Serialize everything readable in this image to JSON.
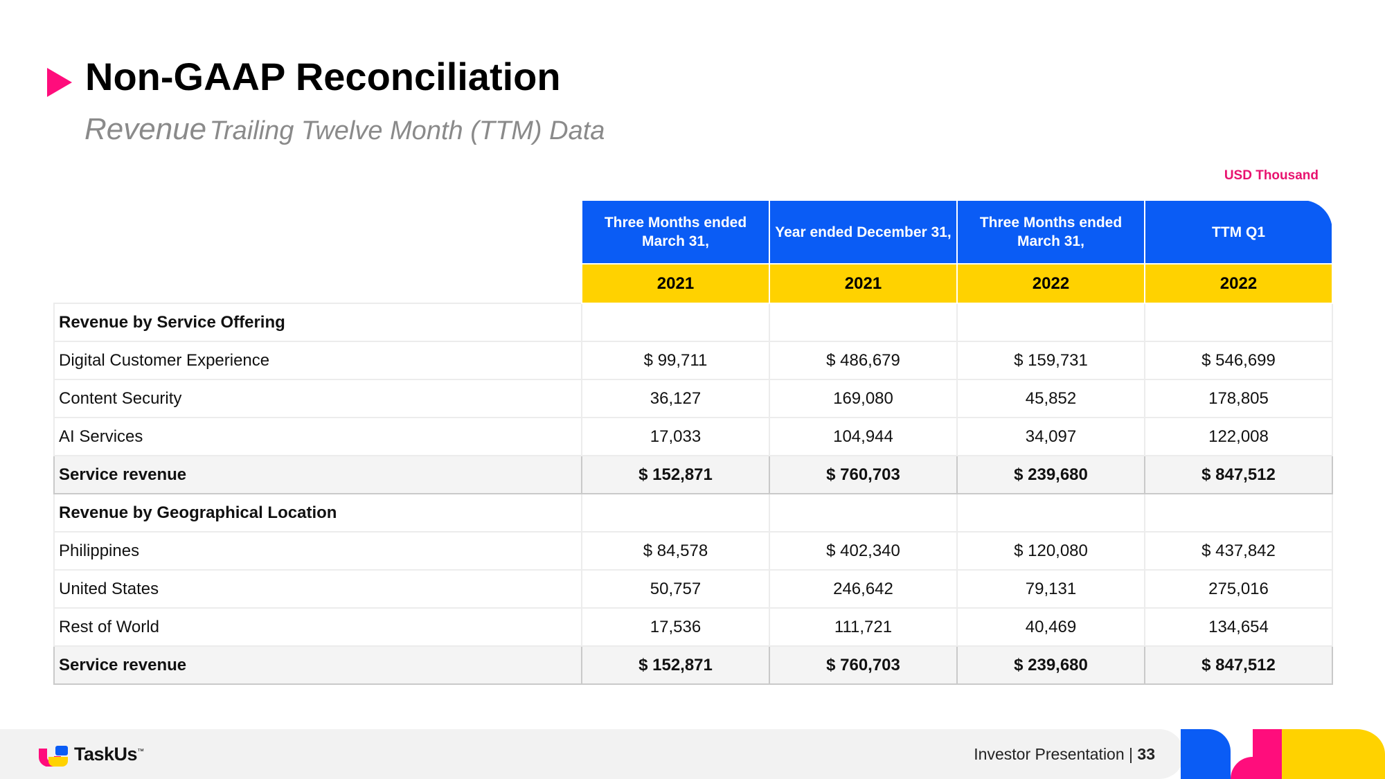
{
  "title": "Non-GAAP Reconciliation",
  "subtitle": {
    "primary": "Revenue",
    "secondary": "Trailing Twelve Month (TTM) Data"
  },
  "units": "USD Thousand",
  "table": {
    "headers": [
      {
        "period": "Three Months ended March 31,",
        "year": "2021"
      },
      {
        "period": "Year ended December 31,",
        "year": "2021"
      },
      {
        "period": "Three Months ended March 31,",
        "year": "2022"
      },
      {
        "period": "TTM Q1",
        "year": "2022"
      }
    ],
    "rows": [
      {
        "kind": "section",
        "label": "Revenue by Service Offering",
        "values": [
          "",
          "",
          "",
          ""
        ]
      },
      {
        "kind": "data",
        "label": "Digital Customer Experience",
        "values": [
          "$ 99,711",
          "$ 486,679",
          "$ 159,731",
          "$ 546,699"
        ]
      },
      {
        "kind": "data",
        "label": "Content Security",
        "values": [
          "36,127",
          "169,080",
          "45,852",
          "178,805"
        ]
      },
      {
        "kind": "data",
        "label": "AI Services",
        "values": [
          "17,033",
          "104,944",
          "34,097",
          "122,008"
        ]
      },
      {
        "kind": "total",
        "label": "Service revenue",
        "values": [
          "$ 152,871",
          "$ 760,703",
          "$ 239,680",
          "$ 847,512"
        ]
      },
      {
        "kind": "section",
        "label": "Revenue by Geographical Location",
        "values": [
          "",
          "",
          "",
          ""
        ]
      },
      {
        "kind": "data",
        "label": "Philippines",
        "values": [
          "$ 84,578",
          "$ 402,340",
          "$ 120,080",
          "$ 437,842"
        ]
      },
      {
        "kind": "data",
        "label": "United States",
        "values": [
          "50,757",
          "246,642",
          "79,131",
          "275,016"
        ]
      },
      {
        "kind": "data",
        "label": "Rest of World",
        "values": [
          "17,536",
          "111,721",
          "40,469",
          "134,654"
        ]
      },
      {
        "kind": "total",
        "label": "Service revenue",
        "values": [
          "$ 152,871",
          "$ 760,703",
          "$ 239,680",
          "$ 847,512"
        ]
      }
    ]
  },
  "footer": {
    "brand": "TaskUs",
    "brand_mark": "™",
    "presentation_label": "Investor Presentation",
    "separator": "|",
    "page_number": "33"
  },
  "colors": {
    "accent_pink": "#ff0d7c",
    "header_blue": "#0a5cf5",
    "header_yellow": "#ffd200",
    "units_pink": "#e8126f"
  }
}
